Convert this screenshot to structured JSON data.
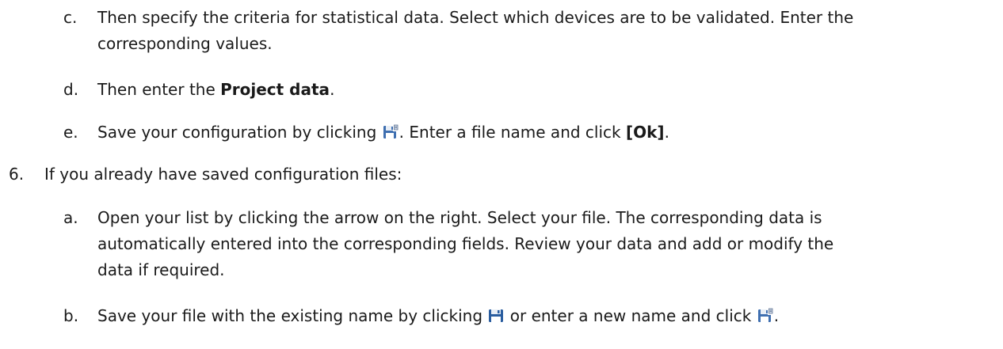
{
  "steps": {
    "c": {
      "marker": "c.",
      "text_line1": "Then specify the criteria for statistical data. Select which devices are to be validated. Enter the",
      "text_line2": "corresponding values."
    },
    "d": {
      "marker": "d.",
      "text_before": "Then enter the ",
      "bold": "Project data",
      "text_after": "."
    },
    "e": {
      "marker": "e.",
      "text_before": "Save your configuration by clicking ",
      "text_middle": ". Enter a file name and click ",
      "bold": "[Ok]",
      "text_after": ".",
      "icon": "save-as-icon"
    },
    "six": {
      "marker": "6.",
      "text": "If you already have saved configuration files:"
    },
    "a": {
      "marker": "a.",
      "text_line1": "Open your list by clicking the arrow on the right. Select your file. The corresponding data is",
      "text_line2": "automatically entered into the corresponding fields. Review your data and add or modify the",
      "text_line3": "data if required."
    },
    "b": {
      "marker": "b.",
      "text_before": "Save your file with the existing name by clicking ",
      "text_middle": " or enter a new name and click ",
      "text_after": ".",
      "icon_save": "save-icon",
      "icon_save_as": "save-as-icon"
    }
  },
  "colors": {
    "save_icon_blue": "#2a5d9f",
    "save_as_icon_blue": "#3f6fb0"
  }
}
